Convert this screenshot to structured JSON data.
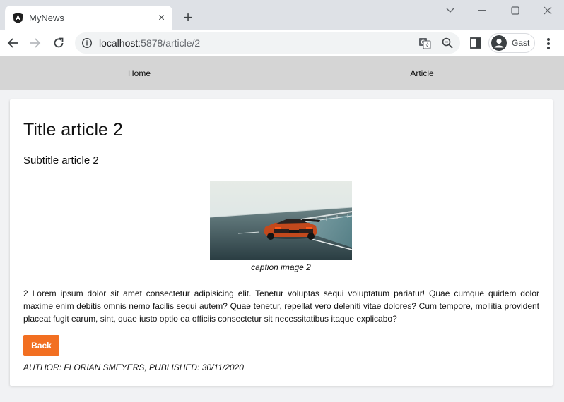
{
  "browser": {
    "tab": {
      "title": "MyNews",
      "favicon": "angular-icon"
    },
    "address_host": "localhost",
    "address_path": ":5878/article/2",
    "profile_name": "Gast"
  },
  "nav": {
    "items": [
      {
        "label": "Home"
      },
      {
        "label": "Article"
      }
    ]
  },
  "article": {
    "title": "Title article 2",
    "subtitle": "Subtitle article 2",
    "caption": "caption image 2",
    "body": "2 Lorem ipsum dolor sit amet consectetur adipisicing elit. Tenetur voluptas sequi voluptatum pariatur! Quae cumque quidem dolor maxime enim debitis omnis nemo facilis sequi autem? Quae tenetur, repellat vero deleniti vitae dolores? Cum tempore, mollitia provident placeat fugit earum, sint, quae iusto optio ea officiis consectetur sit necessitatibus itaque explicabo?",
    "back_label": "Back",
    "meta": "AUTHOR: FLORIAN SMEYERS, PUBLISHED: 30/11/2020"
  },
  "colors": {
    "accent": "#f26f21",
    "navbar_bg": "#d5d5d5"
  }
}
